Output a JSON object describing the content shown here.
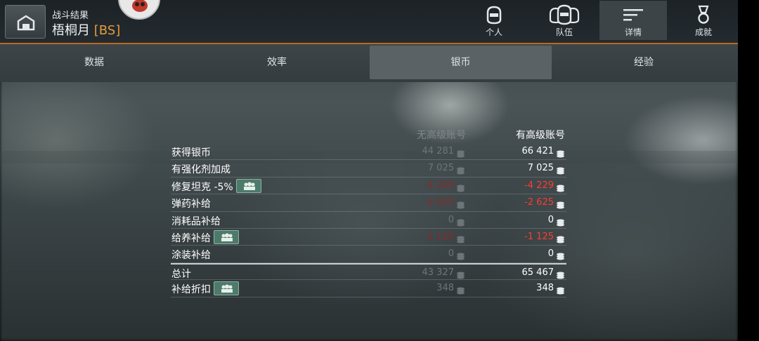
{
  "header": {
    "battle_result": "战斗结果",
    "map_name": "梧桐月",
    "battle_rank": "[BS]"
  },
  "nav": [
    {
      "label": "个人",
      "icon": "player-helmet-icon",
      "active": false
    },
    {
      "label": "队伍",
      "icon": "team-helmets-icon",
      "active": false
    },
    {
      "label": "详情",
      "icon": "details-lines-icon",
      "active": true
    },
    {
      "label": "成就",
      "icon": "medal-icon",
      "active": false
    }
  ],
  "tabs": [
    {
      "label": "数据",
      "active": false
    },
    {
      "label": "效率",
      "active": false
    },
    {
      "label": "银币",
      "active": true
    },
    {
      "label": "经验",
      "active": false
    }
  ],
  "table": {
    "col_no_premium": "无高级账号",
    "col_premium": "有高级账号",
    "rows": [
      {
        "label": "获得银币",
        "no_premium": "44 281",
        "premium": "66 421",
        "negative": false,
        "badge": false
      },
      {
        "label": "有强化剂加成",
        "no_premium": "7 025",
        "premium": "7 025",
        "negative": false,
        "badge": false
      },
      {
        "label": "修复坦克 -5%",
        "no_premium": "-4 229",
        "premium": "-4 229",
        "negative": true,
        "badge": true
      },
      {
        "label": "弹药补给",
        "no_premium": "-2 625",
        "premium": "-2 625",
        "negative": true,
        "badge": false
      },
      {
        "label": "消耗品补给",
        "no_premium": "0",
        "premium": "0",
        "negative": false,
        "badge": false
      },
      {
        "label": "给养补给",
        "no_premium": "-1 125",
        "premium": "-1 125",
        "negative": true,
        "badge": true
      },
      {
        "label": "涂装补给",
        "no_premium": "0",
        "premium": "0",
        "negative": false,
        "badge": false
      },
      {
        "label": "总计",
        "no_premium": "43 327",
        "premium": "65 467",
        "negative": false,
        "badge": false
      },
      {
        "label": "补给折扣",
        "no_premium": "348",
        "premium": "348",
        "negative": false,
        "badge": true
      }
    ]
  },
  "colors": {
    "accent_orange": "#b86a1e",
    "negative_red": "#ff3b30",
    "badge_green": "#4d7a6a"
  }
}
